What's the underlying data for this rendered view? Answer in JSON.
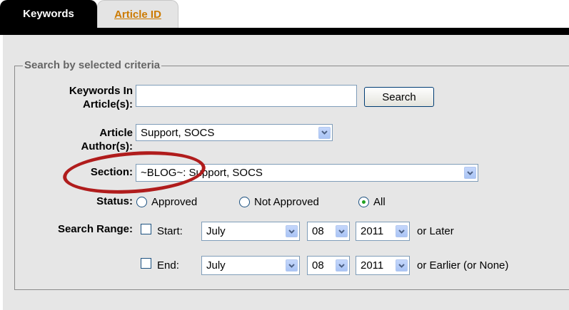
{
  "tabs": [
    {
      "label": "Keywords",
      "active": true
    },
    {
      "label": "Article ID",
      "active": false
    }
  ],
  "fieldset": {
    "legend": "Search by selected criteria"
  },
  "form": {
    "keywords": {
      "label_line1": "Keywords In",
      "label_line2": "Article(s):",
      "value": "",
      "button": "Search"
    },
    "author": {
      "label_line1": "Article",
      "label_line2": "Author(s):",
      "selected": "Support, SOCS"
    },
    "section": {
      "label": "Section:",
      "selected": "~BLOG~: Support, SOCS"
    },
    "status": {
      "label": "Status:",
      "options": [
        "Approved",
        "Not Approved",
        "All"
      ],
      "selected": "All"
    },
    "search_range": {
      "label": "Search Range:",
      "start": {
        "label": "Start:",
        "month": "July",
        "day": "08",
        "year": "2011",
        "suffix": "or Later",
        "checked": false
      },
      "end": {
        "label": "End:",
        "month": "July",
        "day": "08",
        "year": "2011",
        "suffix": "or Earlier (or None)",
        "checked": false
      }
    }
  },
  "colors": {
    "active_tab": "#000000",
    "inactive_tab_text": "#cc7a00",
    "panel": "#e6e6e6",
    "highlight": "#b01c1c"
  },
  "icons": {
    "dropdown": "chevron-down-icon"
  }
}
